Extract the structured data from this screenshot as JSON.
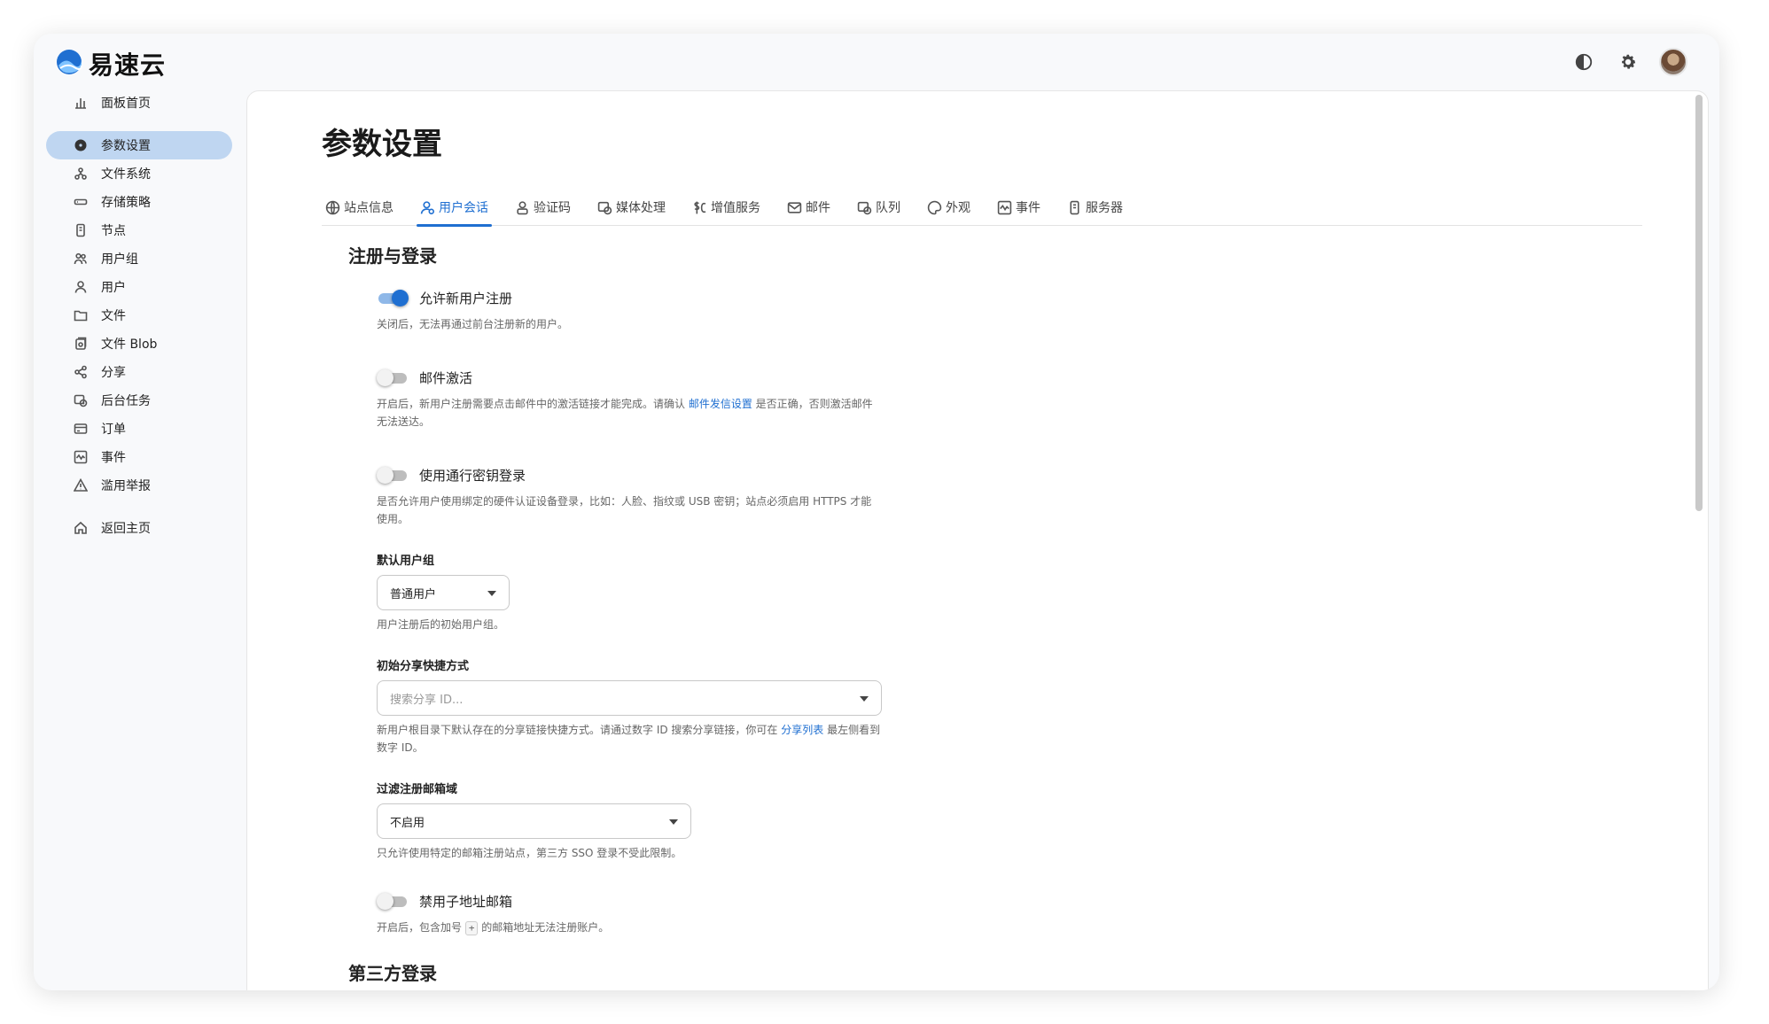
{
  "app": {
    "brand_name": "易速云"
  },
  "header": {
    "actions": [
      {
        "name": "theme-toggle",
        "icon": "contrast-icon"
      },
      {
        "name": "settings",
        "icon": "gear-icon"
      },
      {
        "name": "user-avatar",
        "icon": "avatar"
      }
    ]
  },
  "sidebar": {
    "items": [
      {
        "label": "面板首页",
        "icon": "dashboard-icon"
      },
      {
        "label": "参数设置",
        "icon": "gear-icon",
        "active": true
      },
      {
        "label": "文件系统",
        "icon": "filesystem-icon"
      },
      {
        "label": "存储策略",
        "icon": "storage-icon"
      },
      {
        "label": "节点",
        "icon": "node-icon"
      },
      {
        "label": "用户组",
        "icon": "group-icon"
      },
      {
        "label": "用户",
        "icon": "user-icon"
      },
      {
        "label": "文件",
        "icon": "folder-icon"
      },
      {
        "label": "文件 Blob",
        "icon": "blob-icon"
      },
      {
        "label": "分享",
        "icon": "share-icon"
      },
      {
        "label": "后台任务",
        "icon": "task-icon"
      },
      {
        "label": "订单",
        "icon": "order-icon"
      },
      {
        "label": "事件",
        "icon": "event-icon"
      },
      {
        "label": "滥用举报",
        "icon": "warning-icon"
      },
      {
        "label": "返回主页",
        "icon": "home-icon"
      }
    ]
  },
  "main": {
    "title": "参数设置",
    "tabs": [
      {
        "label": "站点信息",
        "icon": "globe-icon"
      },
      {
        "label": "用户会话",
        "icon": "user-session-icon",
        "active": true
      },
      {
        "label": "验证码",
        "icon": "captcha-icon"
      },
      {
        "label": "媒体处理",
        "icon": "media-icon"
      },
      {
        "label": "增值服务",
        "icon": "currency-icon"
      },
      {
        "label": "邮件",
        "icon": "mail-icon"
      },
      {
        "label": "队列",
        "icon": "queue-icon"
      },
      {
        "label": "外观",
        "icon": "palette-icon"
      },
      {
        "label": "事件",
        "icon": "event-icon"
      },
      {
        "label": "服务器",
        "icon": "server-icon"
      }
    ],
    "section_register": {
      "title": "注册与登录",
      "allow_register": {
        "label": "允许新用户注册",
        "enabled": true,
        "help": "关闭后，无法再通过前台注册新的用户。"
      },
      "email_activation": {
        "label": "邮件激活",
        "enabled": false,
        "help_before": "开启后，新用户注册需要点击邮件中的激活链接才能完成。请确认 ",
        "help_link": "邮件发信设置",
        "help_after": " 是否正确，否则激活邮件无法送达。"
      },
      "passkey_login": {
        "label": "使用通行密钥登录",
        "enabled": false,
        "help": "是否允许用户使用绑定的硬件认证设备登录，比如：人脸、指纹或 USB 密钥；站点必须启用 HTTPS 才能使用。"
      },
      "default_group": {
        "label": "默认用户组",
        "value": "普通用户",
        "help": "用户注册后的初始用户组。"
      },
      "initial_share": {
        "label": "初始分享快捷方式",
        "placeholder": "搜索分享 ID...",
        "help_before": "新用户根目录下默认存在的分享链接快捷方式。请通过数字 ID 搜索分享链接，你可在 ",
        "help_link": "分享列表",
        "help_after": " 最左侧看到数字 ID。"
      },
      "email_domain_filter": {
        "label": "过滤注册邮箱域",
        "value": "不启用",
        "help": "只允许使用特定的邮箱注册站点，第三方 SSO 登录不受此限制。"
      },
      "disable_subaddress": {
        "label": "禁用子地址邮箱",
        "enabled": false,
        "help_before": "开启后，包含加号 ",
        "help_kbd": "+",
        "help_after": " 的邮箱地址无法注册账户。"
      }
    },
    "section_third_party": {
      "title": "第三方登录"
    }
  },
  "colors": {
    "accent": "#1f6fd1",
    "active_nav_bg": "#bfd6f1",
    "switch_on_track": "#8fb8e8"
  }
}
